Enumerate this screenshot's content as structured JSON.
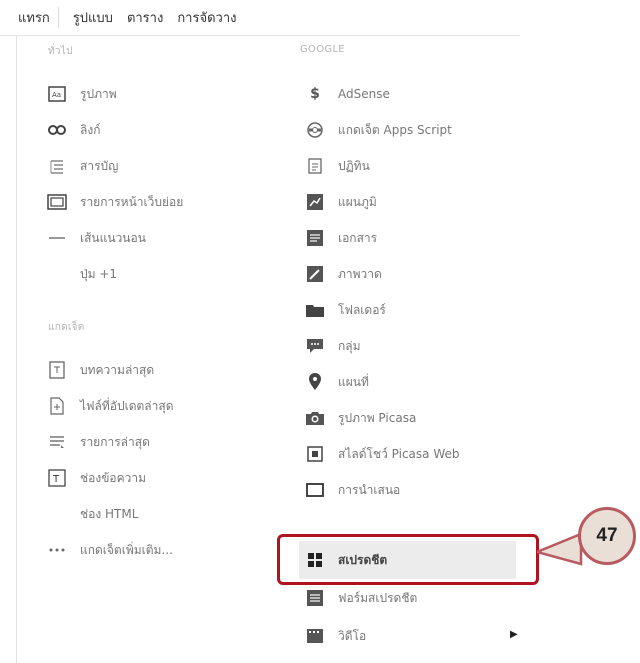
{
  "menu": {
    "tabs": [
      "แทรก",
      "รูปแบบ",
      "ตาราง",
      "การจัดวาง"
    ]
  },
  "left": {
    "section_basic": "ทั่วไป",
    "items_basic": [
      {
        "icon": "image-icon",
        "label": "รูปภาพ"
      },
      {
        "icon": "link-icon",
        "label": "ลิงก์"
      },
      {
        "icon": "toc-icon",
        "label": "สารบัญ"
      },
      {
        "icon": "subpage-list-icon",
        "label": "รายการหน้าเว็บย่อย"
      },
      {
        "icon": "horizontal-line-icon",
        "label": "เส้นแนวนอน"
      },
      {
        "icon": "",
        "label": "ปุ่ม +1"
      }
    ],
    "section_gadgets": "แกดเจ็ต",
    "items_gadgets": [
      {
        "icon": "recent-posts-icon",
        "label": "บทความล่าสุด"
      },
      {
        "icon": "recent-files-icon",
        "label": "ไฟล์ที่อัปเดตล่าสุด"
      },
      {
        "icon": "recent-list-icon",
        "label": "รายการล่าสุด"
      },
      {
        "icon": "text-box-icon",
        "label": "ช่องข้อความ"
      },
      {
        "icon": "",
        "label": "ช่อง HTML"
      },
      {
        "icon": "more-icon",
        "label": "แกดเจ็ตเพิ่มเติม..."
      }
    ]
  },
  "right": {
    "section_google": "GOOGLE",
    "items": [
      {
        "icon": "dollar-icon",
        "label": "AdSense"
      },
      {
        "icon": "apps-script-icon",
        "label": "แกดเจ็ต Apps Script"
      },
      {
        "icon": "calendar-icon",
        "label": "ปฏิทิน"
      },
      {
        "icon": "chart-icon",
        "label": "แผนภูมิ"
      },
      {
        "icon": "document-icon",
        "label": "เอกสาร"
      },
      {
        "icon": "drawing-icon",
        "label": "ภาพวาด"
      },
      {
        "icon": "folder-icon",
        "label": "โฟลเดอร์"
      },
      {
        "icon": "group-icon",
        "label": "กลุ่ม"
      },
      {
        "icon": "map-pin-icon",
        "label": "แผนที่"
      },
      {
        "icon": "camera-icon",
        "label": "รูปภาพ Picasa"
      },
      {
        "icon": "slideshow-icon",
        "label": "สไลด์โชว์ Picasa Web"
      },
      {
        "icon": "presentation-icon",
        "label": "การนำเสนอ"
      },
      {
        "icon": "spreadsheet-icon",
        "label": "สเปรดชีต"
      },
      {
        "icon": "form-icon",
        "label": "ฟอร์มสเปรดชีต"
      },
      {
        "icon": "video-icon",
        "label": "วิดีโอ"
      }
    ]
  },
  "callout": {
    "number": "47"
  },
  "colors": {
    "callout_border": "#b0141f",
    "badge_fill": "#eadfd7",
    "highlight": "#ececec"
  }
}
